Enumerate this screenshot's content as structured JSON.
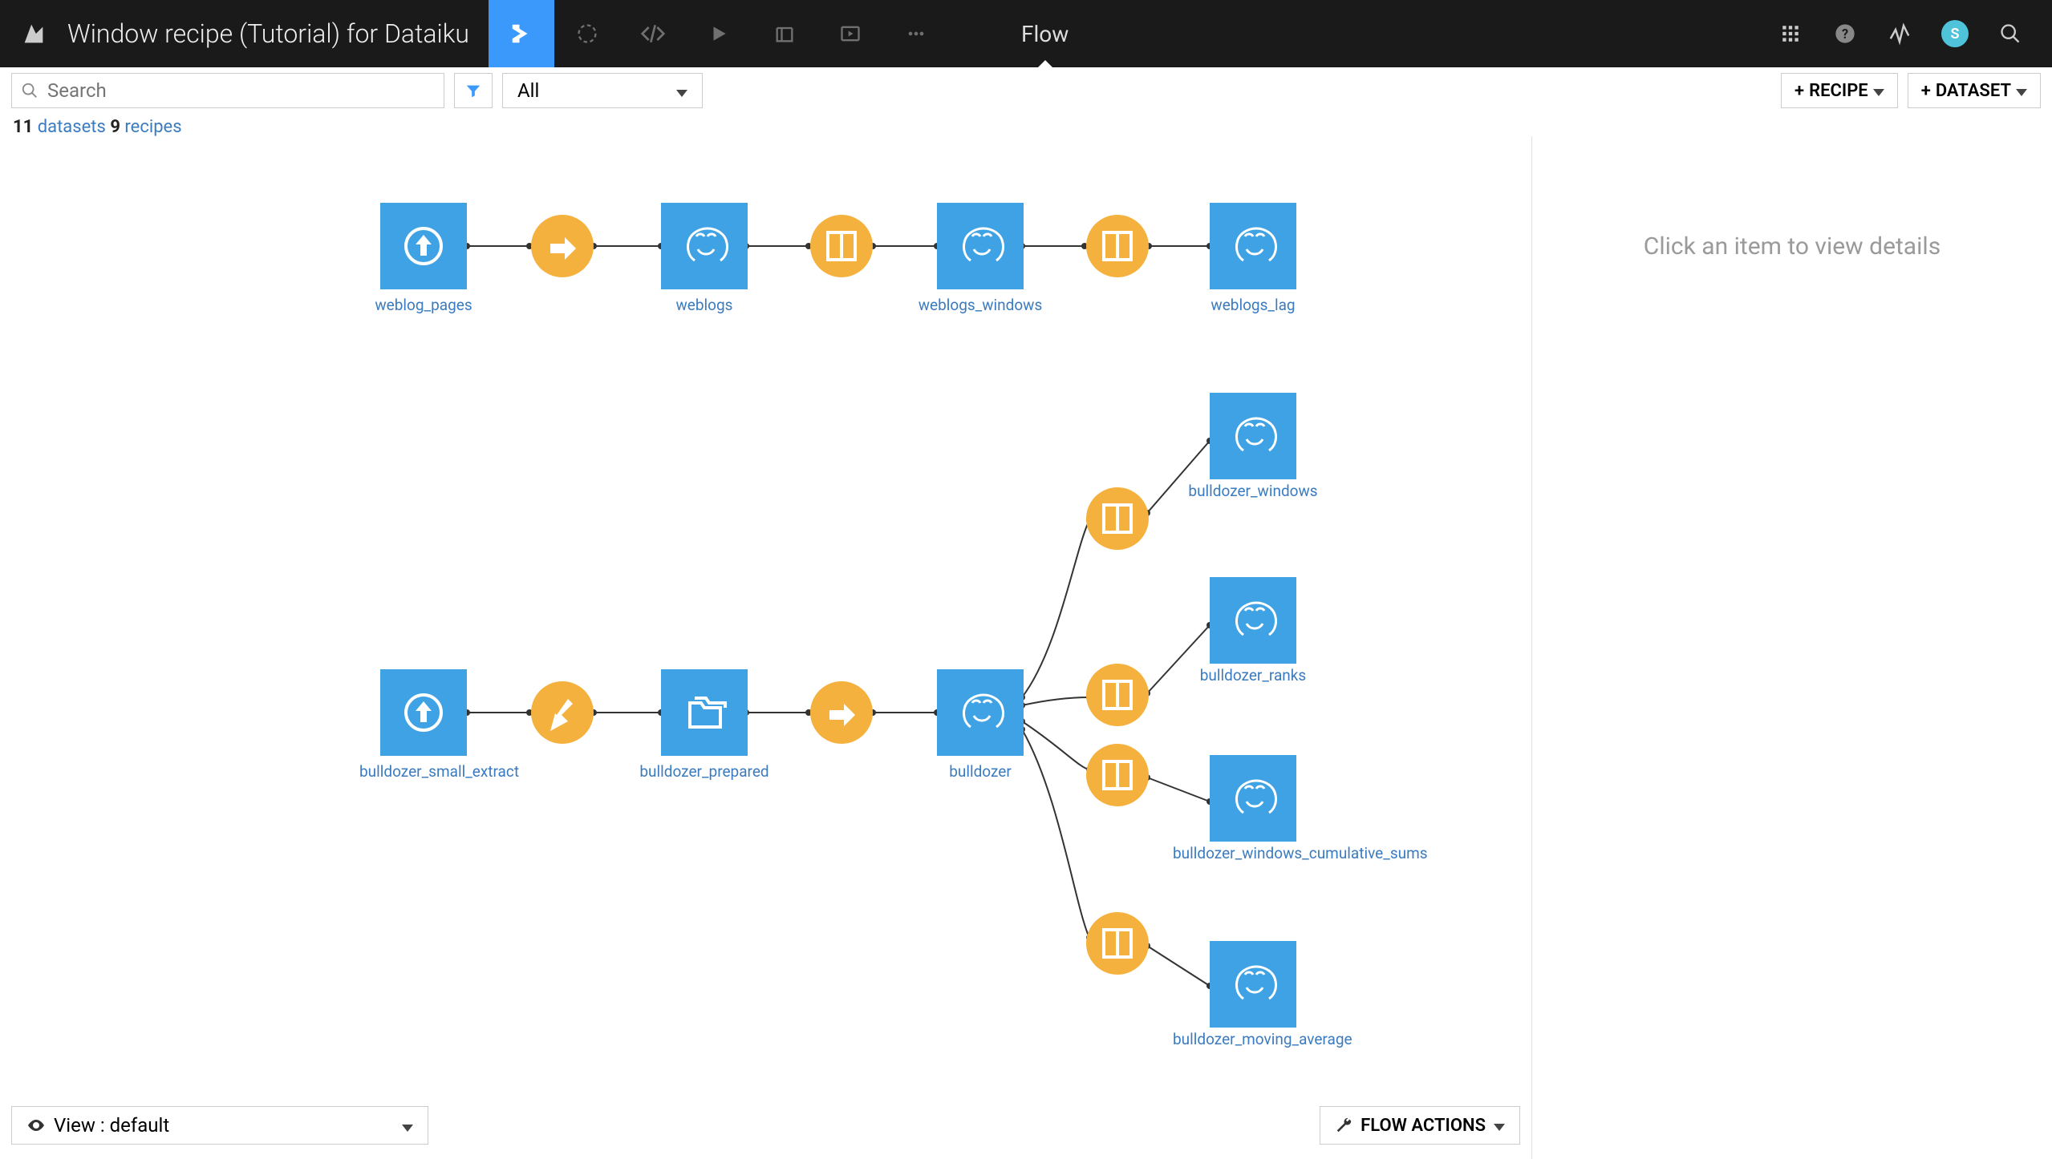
{
  "header": {
    "title": "Window recipe (Tutorial) for Dataiku",
    "breadcrumb": "Flow",
    "avatar_initial": "S"
  },
  "toolbar": {
    "search_placeholder": "Search",
    "filter_label": "All",
    "recipe_btn": "RECIPE",
    "dataset_btn": "DATASET"
  },
  "counts": {
    "datasets_n": "11",
    "datasets_lbl": "datasets",
    "recipes_n": "9",
    "recipes_lbl": "recipes"
  },
  "detail_hint": "Click an item to view details",
  "bottom": {
    "view_label": "View : default",
    "flow_actions": "FLOW ACTIONS"
  },
  "nodes": {
    "ds": {
      "weblog_pages": "weblog_pages",
      "weblogs": "weblogs",
      "weblogs_windows": "weblogs_windows",
      "weblogs_lag": "weblogs_lag",
      "bulldozer_small_extract": "bulldozer_small_extract",
      "bulldozer_prepared": "bulldozer_prepared",
      "bulldozer": "bulldozer",
      "bulldozer_windows": "bulldozer_windows",
      "bulldozer_ranks": "bulldozer_ranks",
      "bulldozer_windows_cumulative_sums": "bulldozer_windows_cumulative_sums",
      "bulldozer_moving_average": "bulldozer_moving_average"
    }
  }
}
